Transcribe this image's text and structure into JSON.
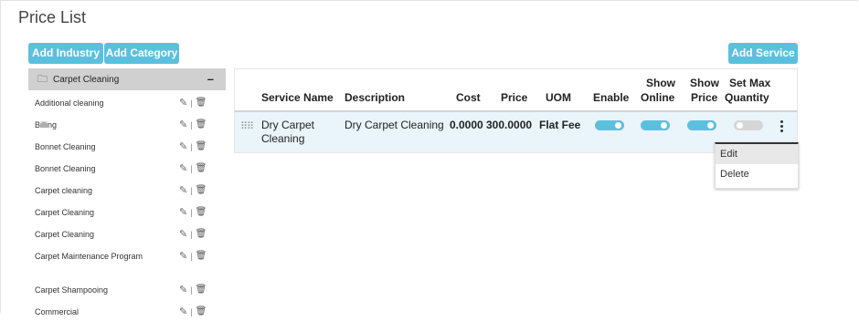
{
  "page": {
    "title": "Price List"
  },
  "buttons": {
    "add_industry": "Add Industry",
    "add_category": "Add Category",
    "add_service": "Add Service"
  },
  "sidebar": {
    "header": "Carpet Cleaning",
    "collapse_symbol": "–",
    "folder_symbol": "🗀",
    "items": [
      "Additional cleaning",
      "Billing",
      "Bonnet Cleaning",
      "Bonnet Cleaning",
      "Carpet cleaning",
      "Carpet Cleaning",
      "Carpet Cleaning",
      "Carpet Maintenance Program",
      "Carpet Shampooing",
      "Commercial"
    ],
    "icons": {
      "edit": "pencil-icon",
      "delete": "trash-icon"
    }
  },
  "table": {
    "headers": {
      "service_name": "Service Name",
      "description": "Description",
      "cost": "Cost",
      "price": "Price",
      "uom": "UOM",
      "enable": "Enable",
      "show_online_1": "Show",
      "show_online_2": "Online",
      "show_price_1": "Show",
      "show_price_2": "Price",
      "set_max_1": "Set Max",
      "set_max_2": "Quantity"
    },
    "rows": [
      {
        "service_name_1": "Dry Carpet",
        "service_name_2": "Cleaning",
        "description": "Dry Carpet Cleaning",
        "cost": "0.0000",
        "price": "300.0000",
        "uom": "Flat Fee",
        "enable": true,
        "show_online": true,
        "show_price": true,
        "set_max_quantity": false
      }
    ]
  },
  "row_menu": {
    "edit": "Edit",
    "delete": "Delete"
  },
  "colors": {
    "accent": "#5bc0de",
    "toggle_off": "#d6d6d6",
    "row_highlight": "#e9f5fa",
    "sidebar_header": "#d0d0d0"
  }
}
